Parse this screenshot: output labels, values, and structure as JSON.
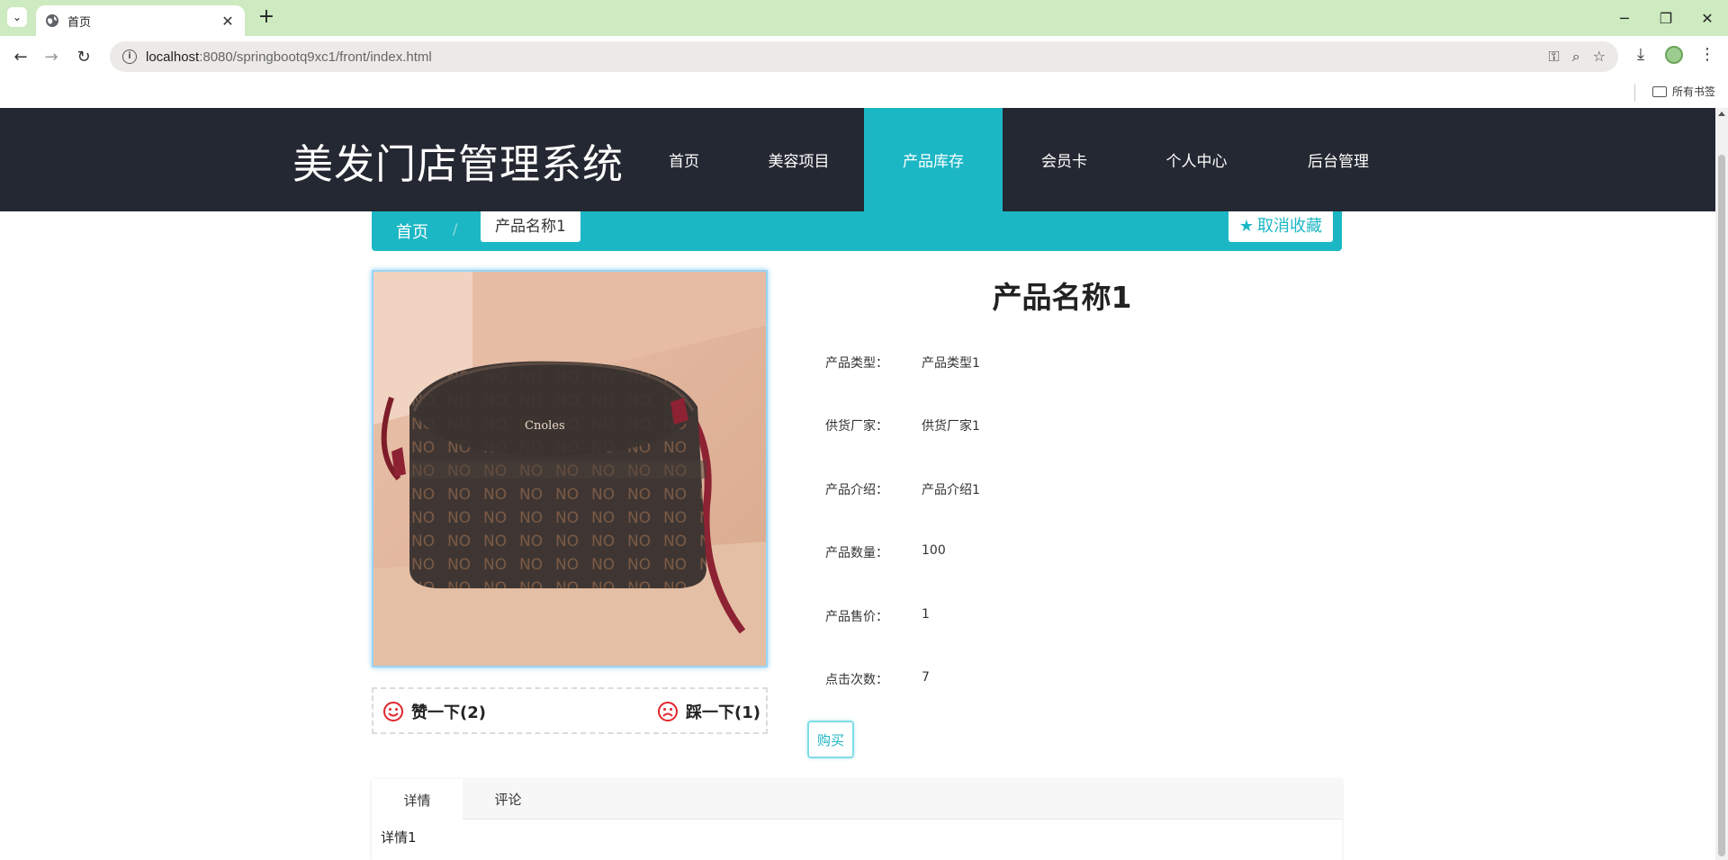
{
  "browser": {
    "tab_title": "首页",
    "url_host": "localhost",
    "url_path": ":8080/springbootq9xc1/front/index.html",
    "bookmarks_label": "所有书签"
  },
  "site": {
    "logo": "美发门店管理系统",
    "nav": [
      {
        "label": "首页",
        "active": false
      },
      {
        "label": "美容项目",
        "active": false
      },
      {
        "label": "产品库存",
        "active": true
      },
      {
        "label": "会员卡",
        "active": false
      },
      {
        "label": "个人中心",
        "active": false
      },
      {
        "label": "后台管理",
        "active": false
      }
    ],
    "accent_color": "#1cb7c5",
    "header_color": "#242832"
  },
  "breadcrumb": {
    "home": "首页",
    "separator": "/",
    "current": "产品名称1"
  },
  "favorite_button": "取消收藏",
  "product": {
    "name": "产品名称1",
    "image_brand_text": "Cnoles",
    "fields": [
      {
        "label": "产品类型：",
        "value": "产品类型1"
      },
      {
        "label": "供货厂家：",
        "value": "供货厂家1"
      },
      {
        "label": "产品介绍：",
        "value": "产品介绍1"
      },
      {
        "label": "产品数量：",
        "value": "100"
      },
      {
        "label": "产品售价：",
        "value": "1"
      },
      {
        "label": "点击次数：",
        "value": "7"
      }
    ]
  },
  "votes": {
    "like": "赞一下(2)",
    "dislike": "踩一下(1)"
  },
  "buy_button": "购买",
  "detail_tabs": {
    "tabs": [
      "详情",
      "评论"
    ],
    "active_index": 0,
    "content": "详情1"
  }
}
